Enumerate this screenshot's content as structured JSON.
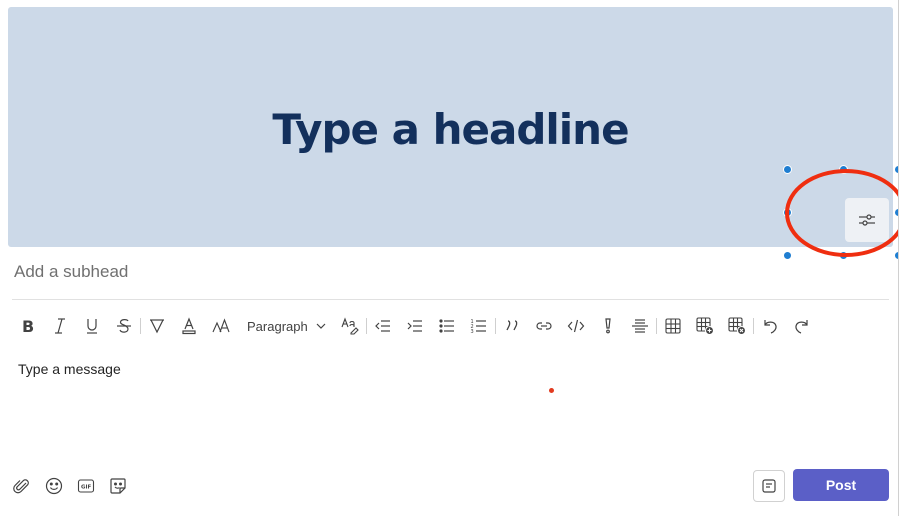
{
  "banner": {
    "headline": "Type a headline",
    "background": "#ccd9e8",
    "headline_color": "#13305c"
  },
  "subhead": {
    "placeholder": "Add a subhead"
  },
  "toolbar": {
    "paragraph_label": "Paragraph",
    "icons": [
      "bold-icon",
      "italic-icon",
      "underline-icon",
      "strikethrough-icon",
      "highlight-icon",
      "font-color-icon",
      "font-size-icon",
      "paragraph-style-dropdown",
      "clear-format-icon",
      "decrease-indent-icon",
      "increase-indent-icon",
      "bulleted-list-icon",
      "numbered-list-icon",
      "quote-icon",
      "link-icon",
      "code-snippet-icon",
      "important-icon",
      "horizontal-rule-icon",
      "insert-table-icon",
      "add-table-row-icon",
      "delete-table-row-icon",
      "undo-icon",
      "redo-icon"
    ]
  },
  "editor": {
    "placeholder": "Type a message"
  },
  "bottom_toolbar": {
    "icons": [
      "attach-icon",
      "emoji-icon",
      "gif-icon",
      "sticker-icon"
    ]
  },
  "actions": {
    "post_label": "Post",
    "post_color": "#5b5fc7"
  },
  "annotation": {
    "color": "#ef2e10"
  }
}
